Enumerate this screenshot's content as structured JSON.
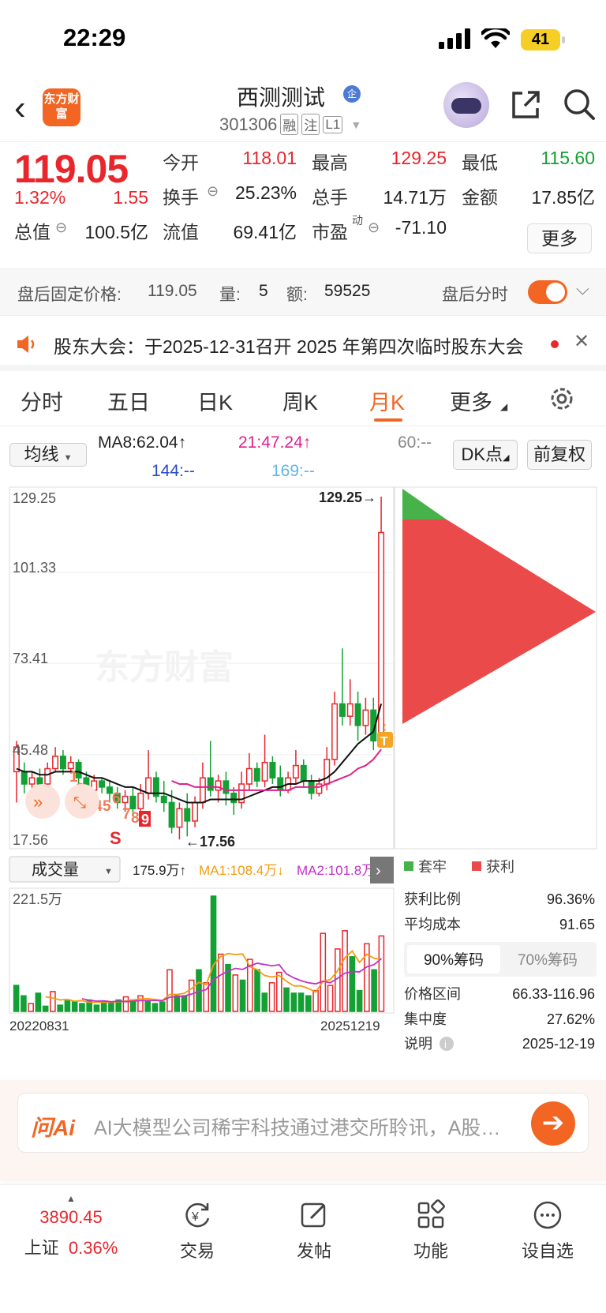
{
  "status_bar": {
    "time": "22:29",
    "battery": "41"
  },
  "header": {
    "back_label": "‹",
    "logo_text": "东方财富",
    "stock_name": "西测测试",
    "qi_badge": "企",
    "stock_code": "301306",
    "tags": [
      "融",
      "注",
      "L1"
    ]
  },
  "quote": {
    "price": "119.05",
    "change_pct": "1.32%",
    "change_amt": "1.55",
    "fields": {
      "open_label": "今开",
      "open": "118.01",
      "high_label": "最高",
      "high": "129.25",
      "low_label": "最低",
      "low": "115.60",
      "turnover_label": "换手",
      "turnover": "25.23%",
      "volume_label": "总手",
      "volume": "14.71万",
      "amount_label": "金额",
      "amount": "17.85亿",
      "mktcap_label": "总值",
      "mktcap": "100.5亿",
      "float_label": "流值",
      "float": "69.41亿",
      "pe_label": "市盈",
      "pe_sup": "动",
      "pe": "-71.10"
    },
    "more_button": "更多"
  },
  "after_hours": {
    "label": "盘后固定价格:",
    "price": "119.05",
    "vol_label": "量:",
    "vol": "5",
    "amt_label": "额:",
    "amt": "59525",
    "timeshare_label": "盘后分时"
  },
  "notice": {
    "text": "股东大会：于2025-12-31召开 2025 年第四次临时股东大会"
  },
  "tabs": [
    {
      "label": "分时"
    },
    {
      "label": "五日"
    },
    {
      "label": "日K"
    },
    {
      "label": "周K"
    },
    {
      "label": "月K"
    },
    {
      "label": "更多"
    }
  ],
  "ma_row": {
    "selector": "均线",
    "ma8": "MA8:62.04↑",
    "ma21": "21:47.24↑",
    "ma60": "60:--",
    "ma144": "144:--",
    "ma169": "169:--",
    "dk_button": "DK点",
    "adjust_button": "前复权"
  },
  "colors": {
    "up": "#e8262c",
    "down": "#13a034",
    "brand": "#f26522",
    "ma8": "#111111",
    "ma21": "#e0208c",
    "ma1": "#f39c12",
    "ma2": "#c231c9"
  },
  "chart_data": {
    "type": "candlestick",
    "y_ticks": [
      "129.25",
      "101.33",
      "73.41",
      "45.48",
      "17.56"
    ],
    "high_marker": "129.25→",
    "low_marker": "←17.56",
    "ylim": [
      17.56,
      129.25
    ],
    "nine_turn_labels": [
      "1",
      "2",
      "3",
      "4",
      "5",
      "6",
      "7",
      "8",
      "9"
    ],
    "signal_s": "S",
    "signal_t": "T",
    "candles": [
      [
        48,
        40,
        30,
        50,
        1
      ],
      [
        40,
        36,
        33,
        43,
        0
      ],
      [
        36,
        38,
        34,
        40,
        1
      ],
      [
        38,
        36,
        33,
        41,
        0
      ],
      [
        36,
        41,
        34,
        43,
        1
      ],
      [
        41,
        45,
        40,
        48,
        1
      ],
      [
        45,
        41,
        39,
        47,
        0
      ],
      [
        41,
        43,
        40,
        45,
        1
      ],
      [
        43,
        38,
        35,
        44,
        0
      ],
      [
        38,
        34,
        30,
        40,
        0
      ],
      [
        34,
        37,
        32,
        39,
        1
      ],
      [
        37,
        35,
        33,
        38,
        0
      ],
      [
        35,
        33,
        30,
        37,
        0
      ],
      [
        33,
        30,
        28,
        35,
        0
      ],
      [
        30,
        32,
        27,
        34,
        1
      ],
      [
        32,
        28,
        26,
        35,
        0
      ],
      [
        28,
        33,
        27,
        36,
        1
      ],
      [
        33,
        38,
        31,
        47,
        1
      ],
      [
        38,
        32,
        30,
        40,
        0
      ],
      [
        32,
        30,
        27,
        37,
        0
      ],
      [
        30,
        22,
        20,
        34,
        0
      ],
      [
        22,
        28,
        18,
        30,
        1
      ],
      [
        28,
        24,
        19,
        33,
        0
      ],
      [
        24,
        30,
        22,
        32,
        1
      ],
      [
        30,
        38,
        28,
        43,
        1
      ],
      [
        38,
        34,
        32,
        50,
        0
      ],
      [
        34,
        37,
        30,
        39,
        1
      ],
      [
        37,
        33,
        29,
        40,
        0
      ],
      [
        33,
        30,
        26,
        35,
        0
      ],
      [
        30,
        36,
        28,
        40,
        1
      ],
      [
        36,
        41,
        34,
        46,
        1
      ],
      [
        41,
        37,
        35,
        43,
        0
      ],
      [
        37,
        43,
        35,
        52,
        1
      ],
      [
        43,
        38,
        36,
        45,
        0
      ],
      [
        38,
        34,
        32,
        42,
        0
      ],
      [
        34,
        38,
        33,
        40,
        1
      ],
      [
        38,
        42,
        36,
        47,
        1
      ],
      [
        42,
        37,
        35,
        44,
        0
      ],
      [
        37,
        33,
        31,
        39,
        0
      ],
      [
        33,
        36,
        32,
        38,
        1
      ],
      [
        36,
        44,
        34,
        48,
        1
      ],
      [
        44,
        62,
        42,
        66,
        1
      ],
      [
        62,
        58,
        55,
        80,
        0
      ],
      [
        58,
        62,
        55,
        70,
        1
      ],
      [
        62,
        55,
        50,
        66,
        0
      ],
      [
        55,
        60,
        52,
        64,
        1
      ],
      [
        60,
        50,
        47,
        64,
        0
      ],
      [
        50,
        117.6,
        48,
        129.25,
        1
      ]
    ],
    "ma8": [
      41,
      40,
      40,
      39,
      39,
      40,
      40,
      40,
      40,
      39,
      38,
      38,
      37,
      36,
      35,
      35,
      34,
      33,
      33,
      33,
      32,
      31,
      30,
      30,
      30,
      31,
      31,
      31,
      31,
      31,
      32,
      33,
      34,
      35,
      35,
      36,
      36,
      37,
      37,
      37,
      38,
      40,
      43,
      46,
      49,
      51,
      53,
      62.04
    ],
    "ma21": [
      0,
      0,
      0,
      0,
      0,
      0,
      0,
      0,
      0,
      0,
      0,
      0,
      0,
      0,
      0,
      0,
      0,
      0,
      0,
      0,
      37,
      36,
      36,
      35,
      35,
      35,
      35,
      34,
      34,
      34,
      34,
      34,
      34,
      34,
      34,
      34,
      35,
      35,
      35,
      35,
      36,
      37,
      38,
      39,
      41,
      42,
      44,
      47.24
    ],
    "chip_panel": {
      "legend_trapped": "套牢",
      "legend_profit": "获利",
      "profit_ratio_label": "获利比例",
      "profit_ratio": "96.36%",
      "avg_cost_label": "平均成本",
      "avg_cost": "91.65",
      "tab_90": "90%筹码",
      "tab_70": "70%筹码",
      "range_label": "价格区间",
      "range": "66.33-116.96",
      "concentration_label": "集中度",
      "concentration": "27.62%",
      "note_label": "说明",
      "note_date": "2025-12-19"
    },
    "volume_panel": {
      "selector": "成交量",
      "vol_value": "175.9万↑",
      "ma1": "MA1:108.4万↓",
      "ma2": "MA2:101.8万",
      "max_label": "221.5万",
      "start_date": "20220831",
      "end_date": "20251219",
      "volumes": [
        50,
        30,
        15,
        35,
        10,
        38,
        12,
        20,
        18,
        15,
        22,
        12,
        20,
        18,
        22,
        28,
        22,
        30,
        20,
        15,
        18,
        80,
        30,
        30,
        60,
        80,
        55,
        221.5,
        110,
        90,
        70,
        60,
        100,
        80,
        35,
        55,
        75,
        45,
        35,
        35,
        30,
        40,
        150,
        50,
        120,
        155,
        105,
        40,
        130,
        80,
        145
      ],
      "vol_colors": [
        0,
        0,
        1,
        0,
        0,
        1,
        0,
        0,
        0,
        0,
        0,
        0,
        0,
        0,
        0,
        1,
        0,
        1,
        0,
        0,
        0,
        1,
        0,
        0,
        1,
        0,
        1,
        0,
        1,
        0,
        1,
        0,
        1,
        0,
        0,
        1,
        1,
        0,
        0,
        0,
        0,
        1,
        1,
        1,
        1,
        1,
        0,
        0,
        1,
        0,
        1
      ]
    }
  },
  "ai_bar": {
    "logo": "问Ai",
    "placeholder": "AI大模型公司稀宇科技通过港交所聆讯，A股相关概念股"
  },
  "bottom_nav": {
    "index_value": "3890.45",
    "index_name": "上证",
    "index_pct": "0.36%",
    "items": [
      {
        "label": "交易"
      },
      {
        "label": "发帖"
      },
      {
        "label": "功能"
      },
      {
        "label": "设自选"
      }
    ]
  }
}
